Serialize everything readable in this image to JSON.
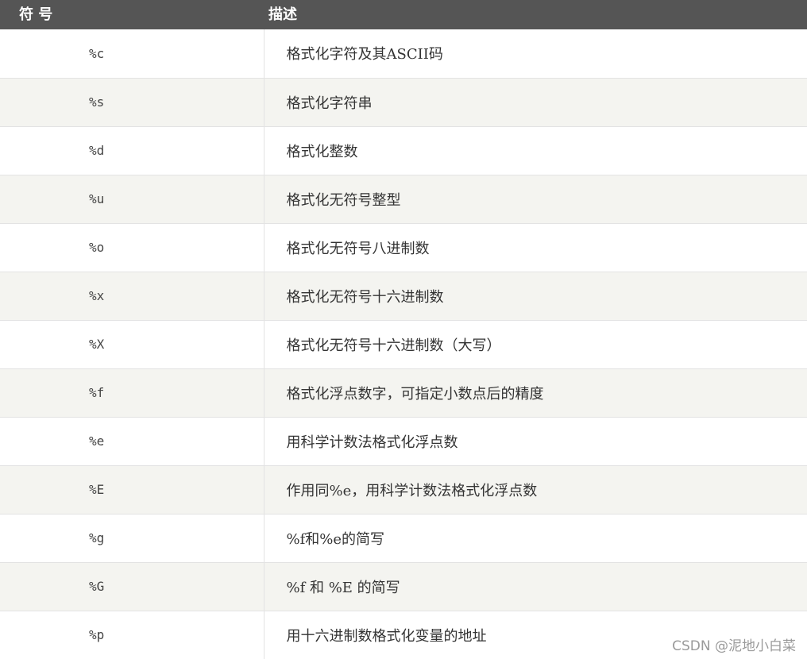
{
  "table": {
    "headers": [
      "符 号",
      "描述"
    ],
    "rows": [
      {
        "symbol": "%c",
        "description": "格式化字符及其ASCII码"
      },
      {
        "symbol": "%s",
        "description": "格式化字符串"
      },
      {
        "symbol": "%d",
        "description": "格式化整数"
      },
      {
        "symbol": "%u",
        "description": "格式化无符号整型"
      },
      {
        "symbol": "%o",
        "description": "格式化无符号八进制数"
      },
      {
        "symbol": "%x",
        "description": "格式化无符号十六进制数"
      },
      {
        "symbol": "%X",
        "description": "格式化无符号十六进制数（大写）"
      },
      {
        "symbol": "%f",
        "description": "格式化浮点数字，可指定小数点后的精度"
      },
      {
        "symbol": "%e",
        "description": "用科学计数法格式化浮点数"
      },
      {
        "symbol": "%E",
        "description": "作用同%e，用科学计数法格式化浮点数"
      },
      {
        "symbol": "%g",
        "description": "%f和%e的简写"
      },
      {
        "symbol": "%G",
        "description": "%f 和 %E 的简写"
      },
      {
        "symbol": "%p",
        "description": "用十六进制数格式化变量的地址"
      }
    ]
  },
  "watermark": "CSDN @泥地小白菜",
  "colors": {
    "header_bg": "#555555",
    "header_text": "#ffffff",
    "stripe_bg": "#f4f4f0",
    "border": "#e3e3e3"
  }
}
